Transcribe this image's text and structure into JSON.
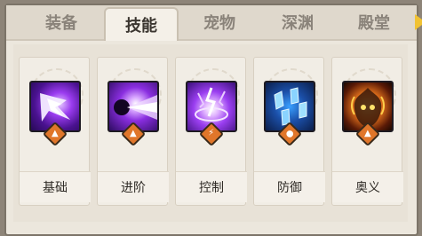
{
  "tabs": [
    {
      "label": "装备",
      "active": false
    },
    {
      "label": "技能",
      "active": true
    },
    {
      "label": "宠物",
      "active": false
    },
    {
      "label": "深渊",
      "active": false
    },
    {
      "label": "殿堂",
      "active": false
    }
  ],
  "skills": [
    {
      "label": "基础",
      "icon": "star-slash-icon",
      "badge_color": "#e0762a",
      "badge_glyph": "▲"
    },
    {
      "label": "进阶",
      "icon": "energy-blast-icon",
      "badge_color": "#e0762a",
      "badge_glyph": "▲"
    },
    {
      "label": "控制",
      "icon": "lightning-burst-icon",
      "badge_color": "#e0762a",
      "badge_glyph": "⚡"
    },
    {
      "label": "防御",
      "icon": "ice-crystal-shield-icon",
      "badge_color": "#e0762a",
      "badge_glyph": "●"
    },
    {
      "label": "奥义",
      "icon": "fire-demon-icon",
      "badge_color": "#e0762a",
      "badge_glyph": "▲"
    }
  ],
  "colors": {
    "panel_bg": "#ece7dd",
    "active_tab_text": "#3b3630",
    "inactive_tab_text": "#8a837a",
    "accent_arrow": "#f1c232"
  }
}
